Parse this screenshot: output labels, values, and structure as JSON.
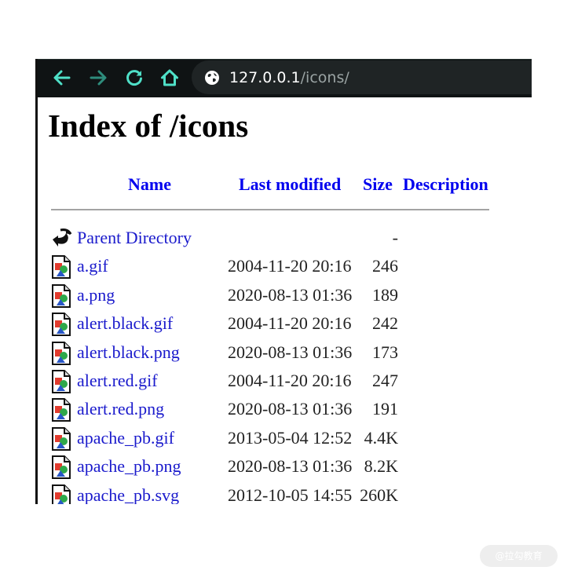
{
  "browser": {
    "url_host": "127.0.0.1",
    "url_path": "/icons/",
    "back_icon": "arrow-left-icon",
    "forward_icon": "arrow-right-icon",
    "reload_icon": "reload-icon",
    "home_icon": "home-icon",
    "site_icon": "globe-icon",
    "accent": "#4fe0c8"
  },
  "page": {
    "title": "Index of /icons",
    "columns": {
      "name": "Name",
      "last_modified": "Last modified",
      "size": "Size",
      "description": "Description"
    },
    "rows": [
      {
        "icon": "parent-directory-icon",
        "name": "Parent Directory",
        "modified": "",
        "size": "-"
      },
      {
        "icon": "image-file-icon",
        "name": "a.gif",
        "modified": "2004-11-20 20:16",
        "size": "246"
      },
      {
        "icon": "image-file-icon",
        "name": "a.png",
        "modified": "2020-08-13 01:36",
        "size": "189"
      },
      {
        "icon": "image-file-icon",
        "name": "alert.black.gif",
        "modified": "2004-11-20 20:16",
        "size": "242"
      },
      {
        "icon": "image-file-icon",
        "name": "alert.black.png",
        "modified": "2020-08-13 01:36",
        "size": "173"
      },
      {
        "icon": "image-file-icon",
        "name": "alert.red.gif",
        "modified": "2004-11-20 20:16",
        "size": "247"
      },
      {
        "icon": "image-file-icon",
        "name": "alert.red.png",
        "modified": "2020-08-13 01:36",
        "size": "191"
      },
      {
        "icon": "image-file-icon",
        "name": "apache_pb.gif",
        "modified": "2013-05-04 12:52",
        "size": "4.4K"
      },
      {
        "icon": "image-file-icon",
        "name": "apache_pb.png",
        "modified": "2020-08-13 01:36",
        "size": "8.2K"
      },
      {
        "icon": "image-file-icon",
        "name": "apache_pb.svg",
        "modified": "2012-10-05 14:55",
        "size": "260K"
      }
    ]
  },
  "watermark": {
    "text": "@拉勾教育"
  }
}
